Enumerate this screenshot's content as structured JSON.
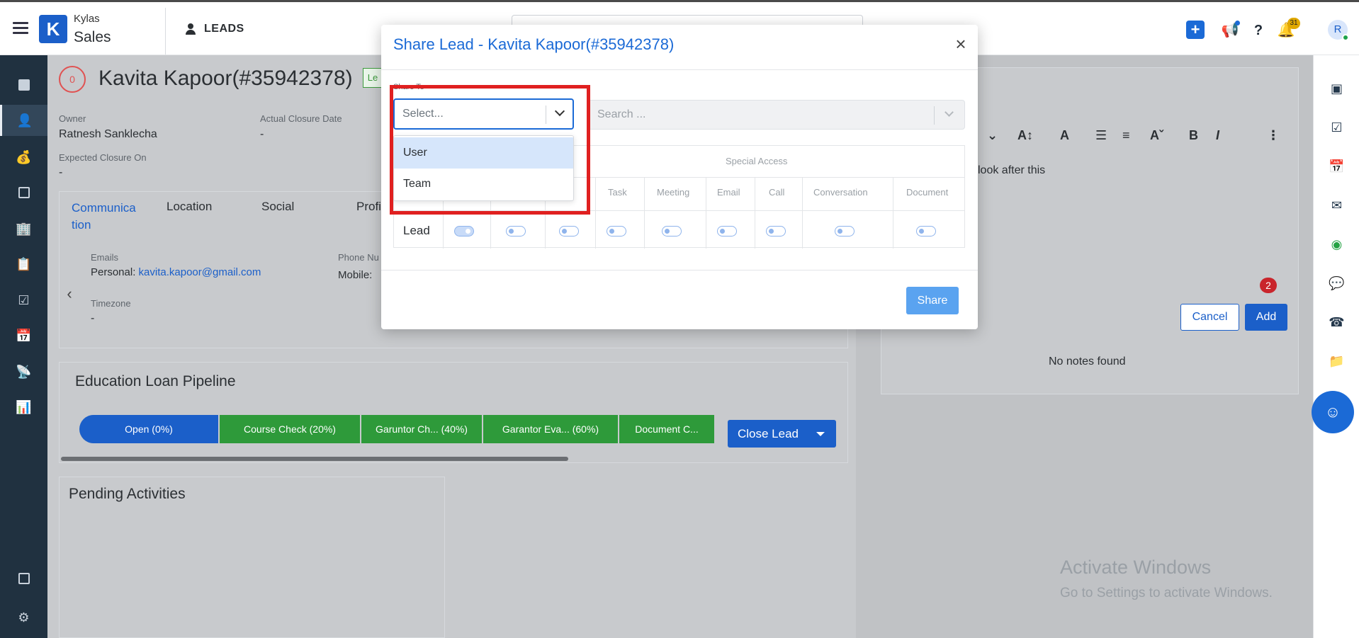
{
  "topbar": {
    "brand_top": "Kylas",
    "brand_bottom": "Sales",
    "module": "LEADS",
    "notification_count": "31",
    "avatar_initial": "R"
  },
  "lead": {
    "score": "0",
    "name": "Kavita Kapoor(#35942378)",
    "status_pill": "Le",
    "owner_label": "Owner",
    "owner_value": "Ratnesh Sanklecha",
    "actual_closure_label": "Actual Closure Date",
    "actual_closure_value": "-",
    "expected_closure_label": "Expected Closure On",
    "expected_closure_value": "-",
    "tabs": [
      "Communica\ntion",
      "Location",
      "Social",
      "Profi"
    ],
    "emails_label": "Emails",
    "email_prefix": "Personal: ",
    "email_value": "kavita.kapoor@gmail.com",
    "phone_label": "Phone Nu",
    "phone_prefix": "Mobile: ",
    "timezone_label": "Timezone",
    "timezone_value": "-"
  },
  "pipeline": {
    "title": "Education Loan Pipeline",
    "stages": [
      "Open (0%)",
      "Course Check (20%)",
      "Garuntor Ch...  (40%)",
      "Garantor Eva... (60%)",
      "Document C..."
    ],
    "close_lead_label": "Close Lead"
  },
  "pending": {
    "title": "Pending Activities"
  },
  "notes": {
    "draft_text": "look after this",
    "comment_count": "2",
    "cancel_label": "Cancel",
    "add_label": "Add",
    "empty_text": "No notes found"
  },
  "watermark": {
    "line1": "Activate Windows",
    "line2": "Go to Settings to activate Windows."
  },
  "modal": {
    "title": "Share Lead - Kavita Kapoor(#35942378)",
    "share_to_label": "Share To",
    "select_placeholder": "Select...",
    "search_placeholder": "Search ...",
    "special_access_label": "Special Access",
    "columns": [
      "te",
      "Task",
      "Meeting",
      "Email",
      "Call",
      "Conversation",
      "Document"
    ],
    "row_label": "Lead",
    "toggles": [
      true,
      false,
      false,
      false,
      false,
      false,
      false,
      false,
      false
    ],
    "share_label": "Share",
    "dropdown_options": [
      "User",
      "Team"
    ],
    "highlighted_option": "User"
  }
}
